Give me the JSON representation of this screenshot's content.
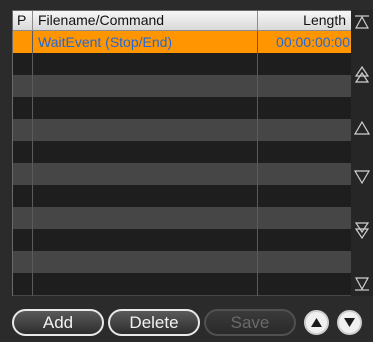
{
  "playlist": {
    "columns": {
      "p": "P",
      "filename": "Filename/Command",
      "length": "Length"
    },
    "rows": [
      {
        "p": "",
        "filename": "WaitEvent (Stop/End)",
        "length": "00:00:00:00",
        "selected": true
      }
    ],
    "selected_row_color": "#ff9500",
    "selected_text_color": "#2468d6"
  },
  "scroll_buttons": [
    {
      "name": "scroll-to-top-icon"
    },
    {
      "name": "page-up-icon"
    },
    {
      "name": "scroll-up-icon"
    },
    {
      "name": "scroll-down-icon"
    },
    {
      "name": "page-down-icon"
    },
    {
      "name": "scroll-to-bottom-icon"
    }
  ],
  "toolbar": {
    "add_label": "Add",
    "delete_label": "Delete",
    "save_label": "Save",
    "save_enabled": false,
    "move_up_icon": "arrow-up-circle-icon",
    "move_down_icon": "arrow-down-circle-icon"
  }
}
